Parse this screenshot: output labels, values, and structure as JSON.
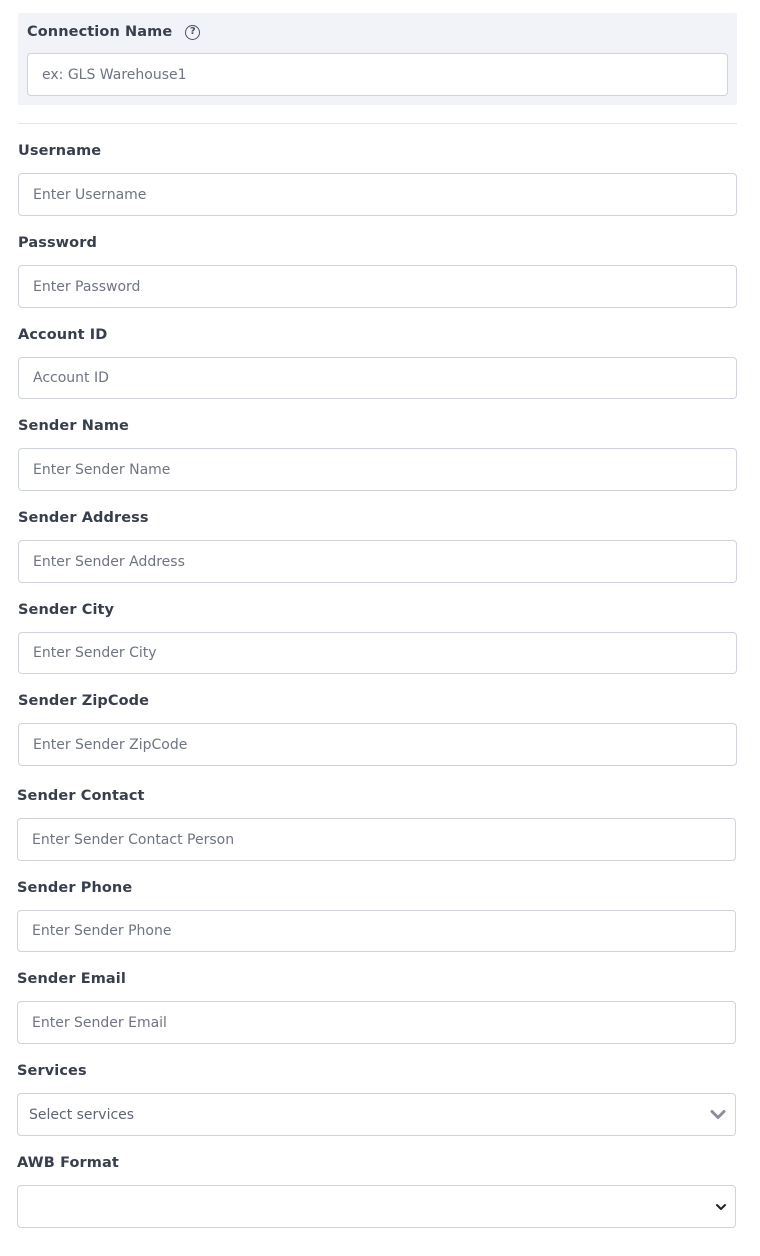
{
  "connection": {
    "label": "Connection Name",
    "help_icon": "question-circle-icon",
    "help_glyph": "?",
    "placeholder": "ex: GLS Warehouse1",
    "value": ""
  },
  "fields": {
    "username": {
      "label": "Username",
      "placeholder": "Enter Username"
    },
    "password": {
      "label": "Password",
      "placeholder": "Enter Password"
    },
    "account_id": {
      "label": "Account ID",
      "placeholder": "Account ID"
    },
    "sender_name": {
      "label": "Sender Name",
      "placeholder": "Enter Sender Name"
    },
    "sender_address": {
      "label": "Sender Address",
      "placeholder": "Enter Sender Address"
    },
    "sender_city": {
      "label": "Sender City",
      "placeholder": "Enter Sender City"
    },
    "sender_zipcode": {
      "label": "Sender ZipCode",
      "placeholder": "Enter Sender ZipCode"
    },
    "sender_contact": {
      "label": "Sender Contact",
      "placeholder": "Enter Sender Contact Person"
    },
    "sender_phone": {
      "label": "Sender Phone",
      "placeholder": "Enter Sender Phone"
    },
    "sender_email": {
      "label": "Sender Email",
      "placeholder": "Enter Sender Email"
    }
  },
  "services": {
    "label": "Services",
    "placeholder": "Select services",
    "icon": "chevron-down-icon",
    "color": "#8a8f99"
  },
  "awb_format": {
    "label": "AWB Format",
    "selected": "",
    "icon": "chevron-down-icon",
    "color": "#222222"
  }
}
